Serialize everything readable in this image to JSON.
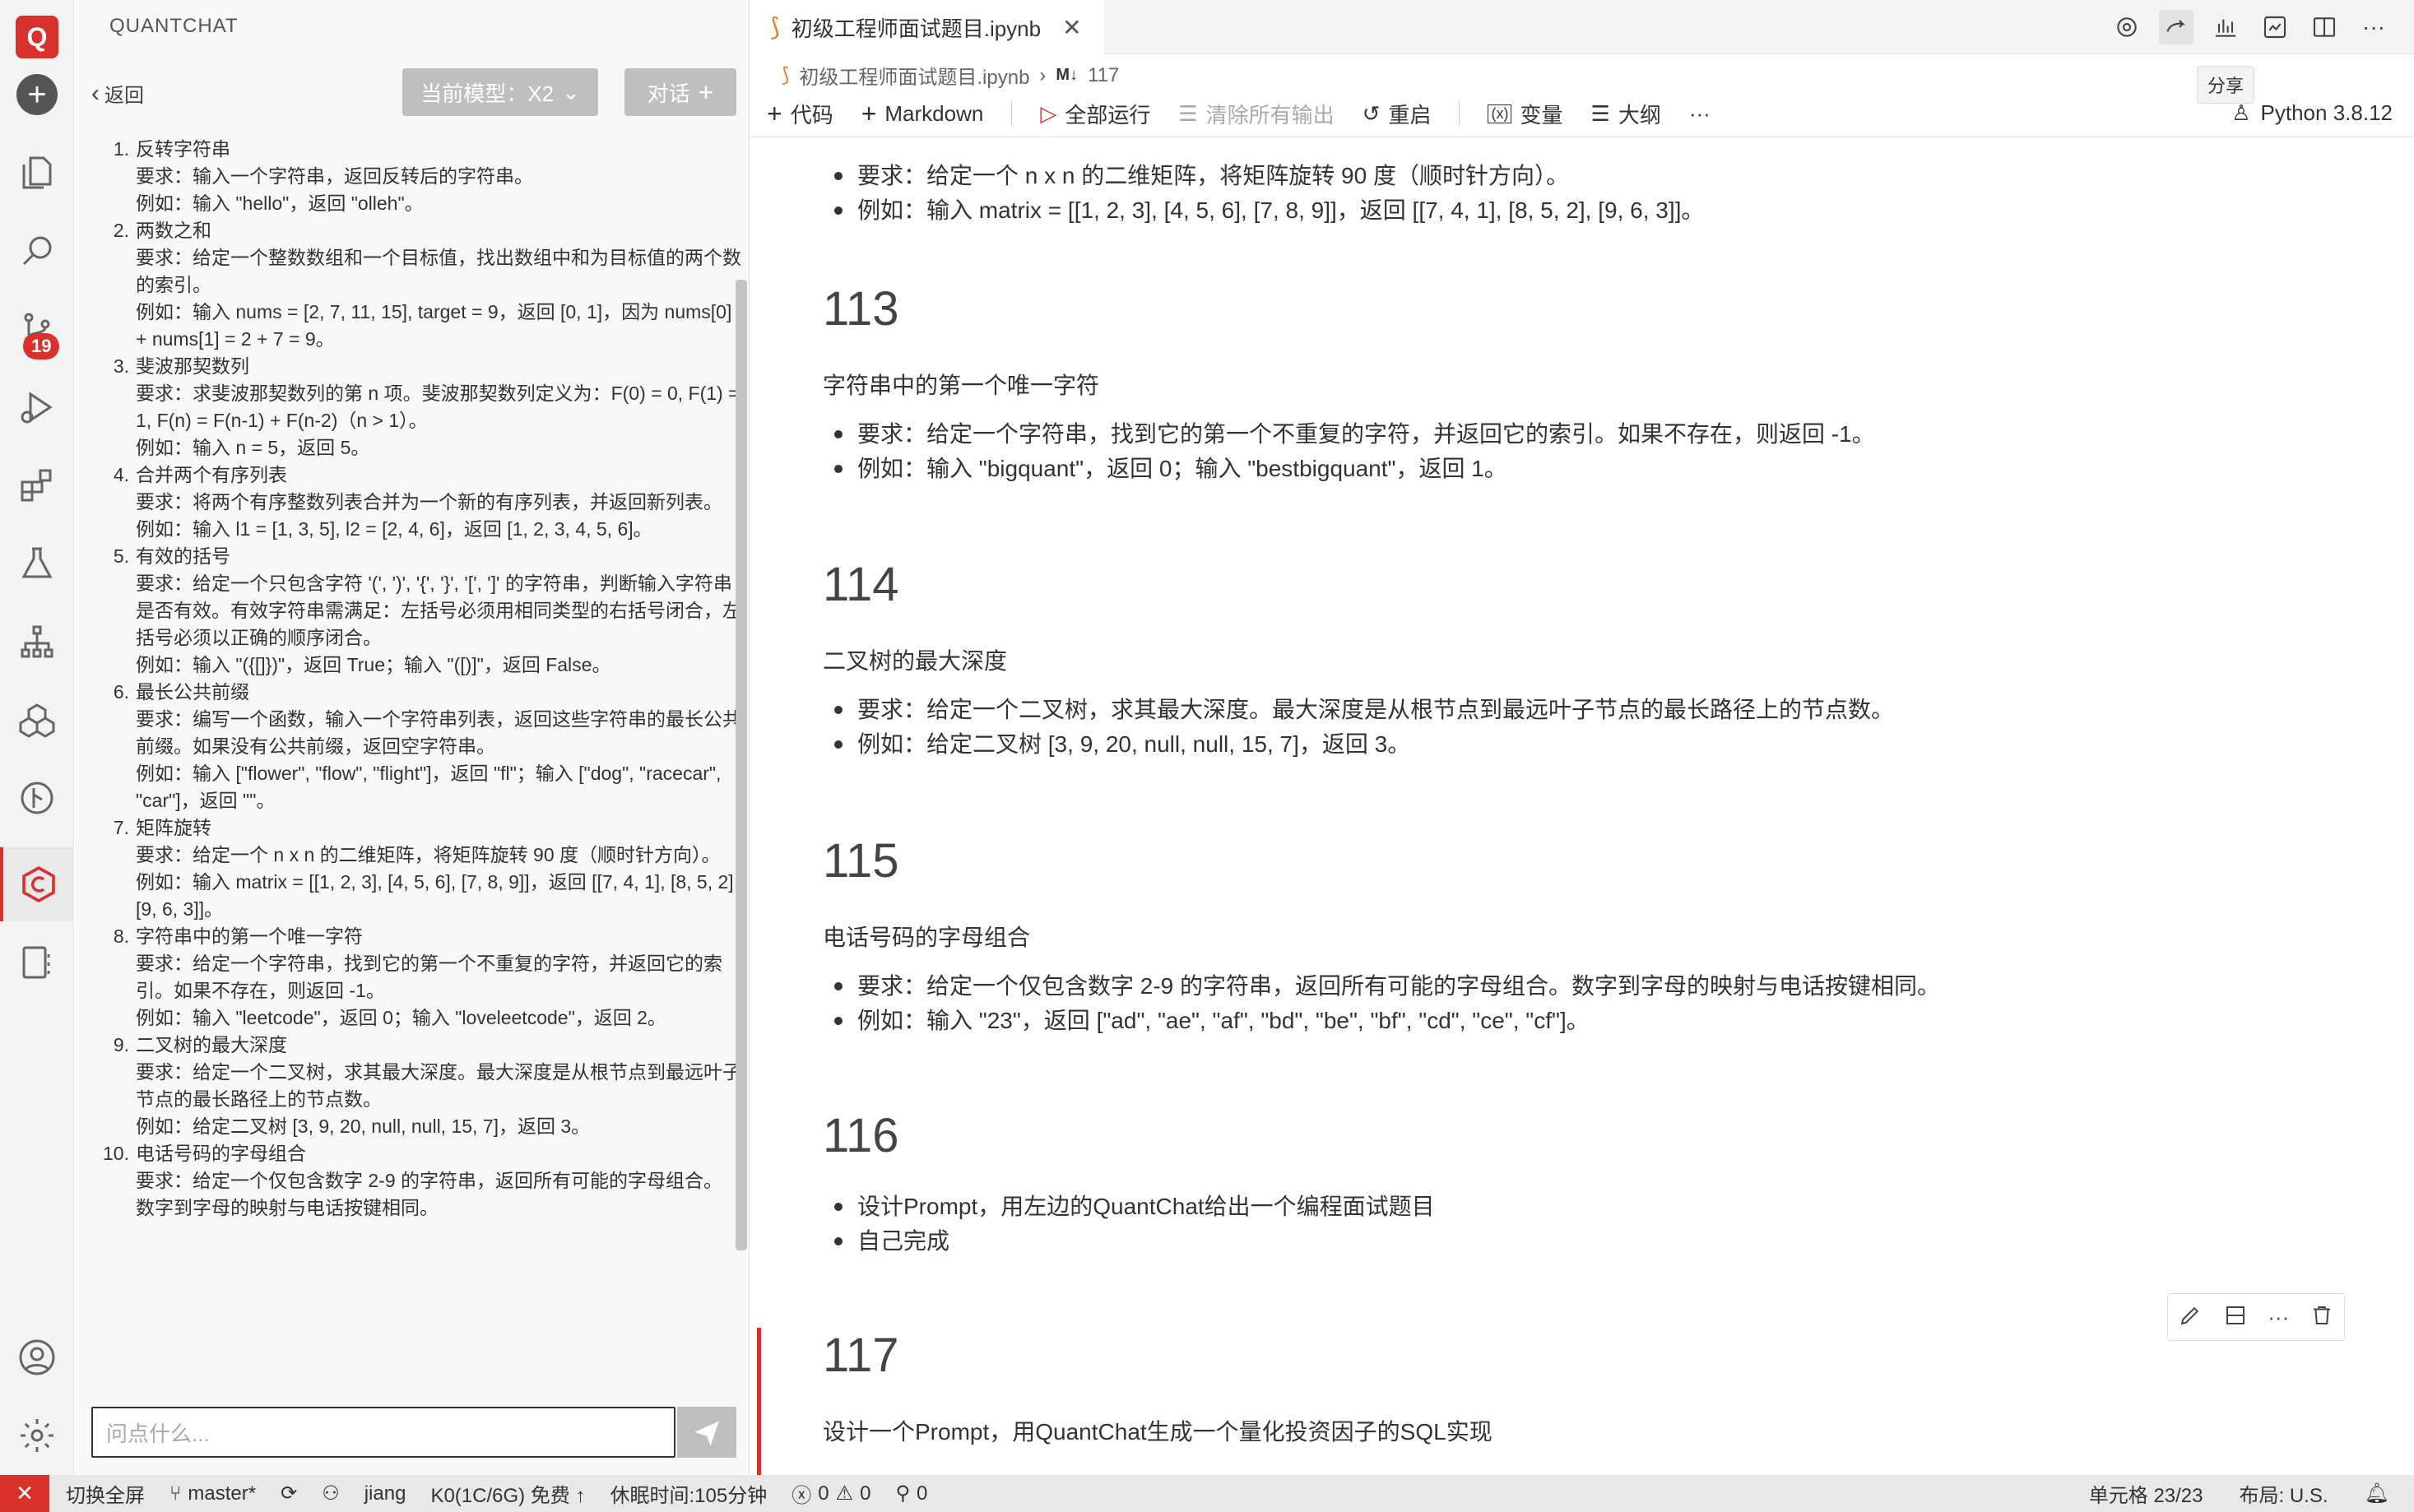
{
  "activity": {
    "logo": "Q",
    "scm_badge": "19"
  },
  "chat": {
    "title": "QUANTCHAT",
    "back_label": "返回",
    "model_label": "当前模型：X2",
    "dialog_label": "对话",
    "input_placeholder": "问点什么...",
    "items": [
      {
        "num": "1.",
        "title": "反转字符串",
        "lines": [
          "要求：输入一个字符串，返回反转后的字符串。",
          "例如：输入 \"hello\"，返回 \"olleh\"。"
        ]
      },
      {
        "num": "2.",
        "title": "两数之和",
        "lines": [
          "要求：给定一个整数数组和一个目标值，找出数组中和为目标值的两个数的索引。",
          "例如：输入 nums = [2, 7, 11, 15], target = 9，返回 [0, 1]，因为 nums[0] + nums[1] = 2 + 7 = 9。"
        ]
      },
      {
        "num": "3.",
        "title": "斐波那契数列",
        "lines": [
          "要求：求斐波那契数列的第 n 项。斐波那契数列定义为：F(0) = 0, F(1) = 1, F(n) = F(n-1) + F(n-2)（n > 1）。",
          "例如：输入 n = 5，返回 5。"
        ]
      },
      {
        "num": "4.",
        "title": "合并两个有序列表",
        "lines": [
          "要求：将两个有序整数列表合并为一个新的有序列表，并返回新列表。",
          "例如：输入 l1 = [1, 3, 5], l2 = [2, 4, 6]，返回 [1, 2, 3, 4, 5, 6]。"
        ]
      },
      {
        "num": "5.",
        "title": "有效的括号",
        "lines": [
          "要求：给定一个只包含字符 '(', ')', '{', '}', '[', ']' 的字符串，判断输入字符串是否有效。有效字符串需满足：左括号必须用相同类型的右括号闭合，左括号必须以正确的顺序闭合。",
          "例如：输入 \"({[]})\"，返回 True；输入 \"([)]\"，返回 False。"
        ]
      },
      {
        "num": "6.",
        "title": "最长公共前缀",
        "lines": [
          "要求：编写一个函数，输入一个字符串列表，返回这些字符串的最长公共前缀。如果没有公共前缀，返回空字符串。",
          "例如：输入 [\"flower\", \"flow\", \"flight\"]，返回 \"fl\"；输入 [\"dog\", \"racecar\", \"car\"]，返回 \"\"。"
        ]
      },
      {
        "num": "7.",
        "title": "矩阵旋转",
        "lines": [
          "要求：给定一个 n x n 的二维矩阵，将矩阵旋转 90 度（顺时针方向）。",
          "例如：输入 matrix = [[1, 2, 3], [4, 5, 6], [7, 8, 9]]，返回 [[7, 4, 1], [8, 5, 2], [9, 6, 3]]。"
        ]
      },
      {
        "num": "8.",
        "title": "字符串中的第一个唯一字符",
        "lines": [
          "要求：给定一个字符串，找到它的第一个不重复的字符，并返回它的索引。如果不存在，则返回 -1。",
          "例如：输入 \"leetcode\"，返回 0；输入 \"loveleetcode\"，返回 2。"
        ]
      },
      {
        "num": "9.",
        "title": "二叉树的最大深度",
        "lines": [
          "要求：给定一个二叉树，求其最大深度。最大深度是从根节点到最远叶子节点的最长路径上的节点数。",
          "例如：给定二叉树 [3, 9, 20, null, null, 15, 7]，返回 3。"
        ]
      },
      {
        "num": "10.",
        "title": "电话号码的字母组合",
        "lines": [
          "要求：给定一个仅包含数字 2-9 的字符串，返回所有可能的字母组合。数字到字母的映射与电话按键相同。"
        ]
      }
    ]
  },
  "editor": {
    "tab_label": "初级工程师面试题目.ipynb",
    "tooltip": "分享",
    "breadcrumb_file": "初级工程师面试题目.ipynb",
    "breadcrumb_cell": "117",
    "toolbar": {
      "code": "代码",
      "markdown": "Markdown",
      "run_all": "全部运行",
      "clear_all": "清除所有输出",
      "restart": "重启",
      "variables": "变量",
      "outline": "大纲",
      "more": "···"
    },
    "kernel": "Python 3.8.12"
  },
  "notebook": {
    "cell_top": {
      "bullets": [
        "要求：给定一个 n x n 的二维矩阵，将矩阵旋转 90 度（顺时针方向）。",
        "例如：输入 matrix = [[1, 2, 3], [4, 5, 6], [7, 8, 9]]，返回 [[7, 4, 1], [8, 5, 2], [9, 6, 3]]。"
      ]
    },
    "c113": {
      "heading": "113",
      "para": "字符串中的第一个唯一字符",
      "bullets": [
        "要求：给定一个字符串，找到它的第一个不重复的字符，并返回它的索引。如果不存在，则返回 -1。",
        "例如：输入 \"bigquant\"，返回 0；输入 \"bestbigquant\"，返回 1。"
      ]
    },
    "c114": {
      "heading": "114",
      "para": "二叉树的最大深度",
      "bullets": [
        "要求：给定一个二叉树，求其最大深度。最大深度是从根节点到最远叶子节点的最长路径上的节点数。",
        "例如：给定二叉树 [3, 9, 20, null, null, 15, 7]，返回 3。"
      ]
    },
    "c115": {
      "heading": "115",
      "para": "电话号码的字母组合",
      "bullets": [
        "要求：给定一个仅包含数字 2-9 的字符串，返回所有可能的字母组合。数字到字母的映射与电话按键相同。",
        "例如：输入 \"23\"，返回 [\"ad\", \"ae\", \"af\", \"bd\", \"be\", \"bf\", \"cd\", \"ce\", \"cf\"]。"
      ]
    },
    "c116": {
      "heading": "116",
      "bullets": [
        "设计Prompt，用左边的QuantChat给出一个编程面试题目",
        "自己完成"
      ]
    },
    "c117": {
      "heading": "117",
      "para": "设计一个Prompt，用QuantChat生成一个量化投资因子的SQL实现"
    }
  },
  "status": {
    "fullscreen": "切换全屏",
    "branch": "master*",
    "user": "jiang",
    "resource": "K0(1C/6G) 免费 ↑",
    "sleep": "休眠时间:105分钟",
    "errors": "0",
    "warnings": "0",
    "ports": "0",
    "cell": "单元格 23/23",
    "layout": "布局: U.S."
  },
  "colors": {
    "accent": "#d9322c",
    "button_gray": "#bfbfbf"
  }
}
